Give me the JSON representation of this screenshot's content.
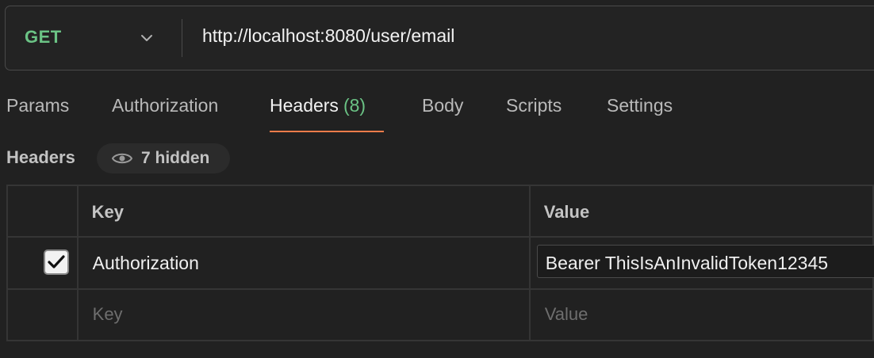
{
  "request": {
    "method": "GET",
    "url": "http://localhost:8080/user/email"
  },
  "tabs": [
    {
      "label": "Params"
    },
    {
      "label": "Authorization"
    },
    {
      "label": "Headers",
      "count": "(8)",
      "active": true
    },
    {
      "label": "Body"
    },
    {
      "label": "Scripts"
    },
    {
      "label": "Settings"
    }
  ],
  "headers_section": {
    "title": "Headers",
    "hidden_label": "7 hidden"
  },
  "table": {
    "columns": [
      "Key",
      "Value"
    ],
    "rows": [
      {
        "checked": true,
        "key": "Authorization",
        "value": "Bearer ThisIsAnInvalidToken12345"
      }
    ],
    "new_row": {
      "key_placeholder": "Key",
      "value_placeholder": "Value"
    }
  },
  "colors": {
    "method_get": "#6bc385",
    "active_tab_underline": "#f37c4a",
    "header_count": "#6bc385"
  }
}
